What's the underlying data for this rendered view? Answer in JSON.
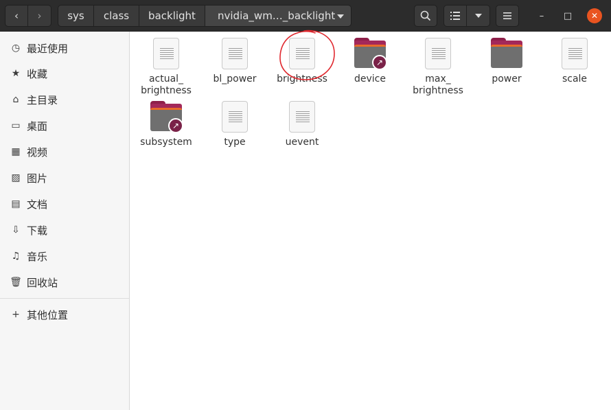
{
  "header": {
    "nav_back_icon": "‹",
    "nav_forward_icon": "›",
    "breadcrumbs": [
      {
        "label": "sys"
      },
      {
        "label": "class"
      },
      {
        "label": "backlight"
      },
      {
        "label": "nvidia_wm…_backlight"
      }
    ],
    "search_icon": "⌕",
    "view_icon": "☰",
    "dropdown_icon": "▾",
    "menu_icon": "≡",
    "minimize_icon": "–",
    "maximize_icon": "□",
    "close_icon": "✕"
  },
  "sidebar": {
    "items": [
      {
        "label": "最近使用",
        "icon": "◷"
      },
      {
        "label": "收藏",
        "icon": "★"
      },
      {
        "label": "主目录",
        "icon": "⌂"
      },
      {
        "label": "桌面",
        "icon": "▭"
      },
      {
        "label": "视频",
        "icon": "▦"
      },
      {
        "label": "图片",
        "icon": "▨"
      },
      {
        "label": "文档",
        "icon": "▤"
      },
      {
        "label": "下载",
        "icon": "⇩"
      },
      {
        "label": "音乐",
        "icon": "♫"
      },
      {
        "label": "回收站",
        "icon": "🗑"
      },
      {
        "label": "其他位置",
        "icon": "+"
      }
    ]
  },
  "files": [
    {
      "name": "actual_\nbrightness",
      "line1": "actual_",
      "line2": "brightness",
      "type": "document"
    },
    {
      "name": "bl_power",
      "line1": "bl_power",
      "line2": "",
      "type": "document"
    },
    {
      "name": "brightness",
      "line1": "brightness",
      "line2": "",
      "type": "document"
    },
    {
      "name": "device",
      "line1": "device",
      "line2": "",
      "type": "folder-link"
    },
    {
      "name": "max_\nbrightness",
      "line1": "max_",
      "line2": "brightness",
      "type": "document"
    },
    {
      "name": "power",
      "line1": "power",
      "line2": "",
      "type": "folder"
    },
    {
      "name": "scale",
      "line1": "scale",
      "line2": "",
      "type": "document"
    },
    {
      "name": "subsystem",
      "line1": "subsystem",
      "line2": "",
      "type": "folder-link"
    },
    {
      "name": "type",
      "line1": "type",
      "line2": "",
      "type": "document"
    },
    {
      "name": "uevent",
      "line1": "uevent",
      "line2": "",
      "type": "document"
    }
  ],
  "link_icon": "↗",
  "colors": {
    "accent": "#e95420",
    "folder": "#a3285a",
    "annotation": "#e0282e"
  }
}
